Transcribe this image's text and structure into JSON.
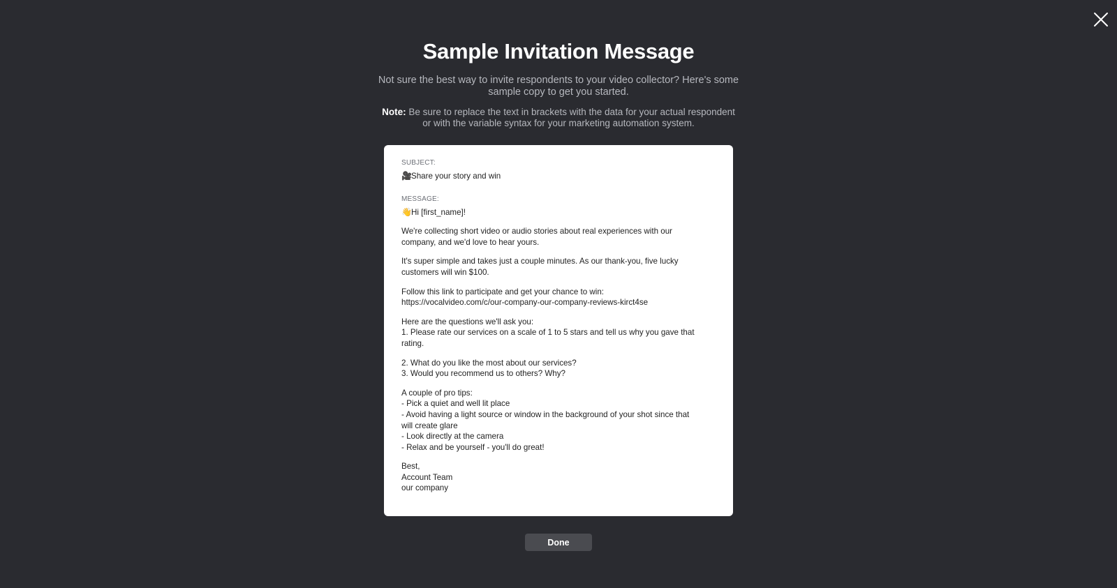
{
  "dialog": {
    "title": "Sample Invitation Message",
    "intro": "Not sure the best way to invite respondents to your video collector? Here's some sample copy to get you started.",
    "note_label": "Note:",
    "note_text": " Be sure to replace the text in brackets with the data for your actual respondent or with the variable syntax for your marketing automation system.",
    "done_label": "Done",
    "close_icon": "close-icon"
  },
  "email": {
    "subject_label": "SUBJECT:",
    "subject_emoji": "🎥",
    "subject_text": "Share your story and win",
    "message_label": "MESSAGE:",
    "greeting_emoji": "👋",
    "greeting_text": "Hi [first_name]!",
    "p1": [
      "We're collecting short video or audio stories about real experiences with our",
      "company, and we'd love to hear yours."
    ],
    "p2": [
      "It's super simple and takes just a couple minutes. As our thank-you, five lucky",
      "customers will win $100."
    ],
    "p3": [
      "Follow this link to participate and get your chance to win:",
      "https://vocalvideo.com/c/our-company-our-company-reviews-kirct4se"
    ],
    "p4": [
      "Here are the questions we'll ask you:",
      "1. Please rate our services on a scale of 1 to 5 stars and tell us why you gave that",
      "rating."
    ],
    "p5": [
      "2. What do you like the most about our services?",
      "3. Would you recommend us to others? Why?"
    ],
    "p6": [
      "A couple of pro tips:",
      "- Pick a quiet and well lit place",
      "- Avoid having a light source or window in the background of your shot since that",
      "will create glare",
      "- Look directly at the camera",
      "- Relax and be yourself - you'll do great!"
    ],
    "p7": [
      "Best,",
      "Account Team",
      "our company"
    ]
  }
}
